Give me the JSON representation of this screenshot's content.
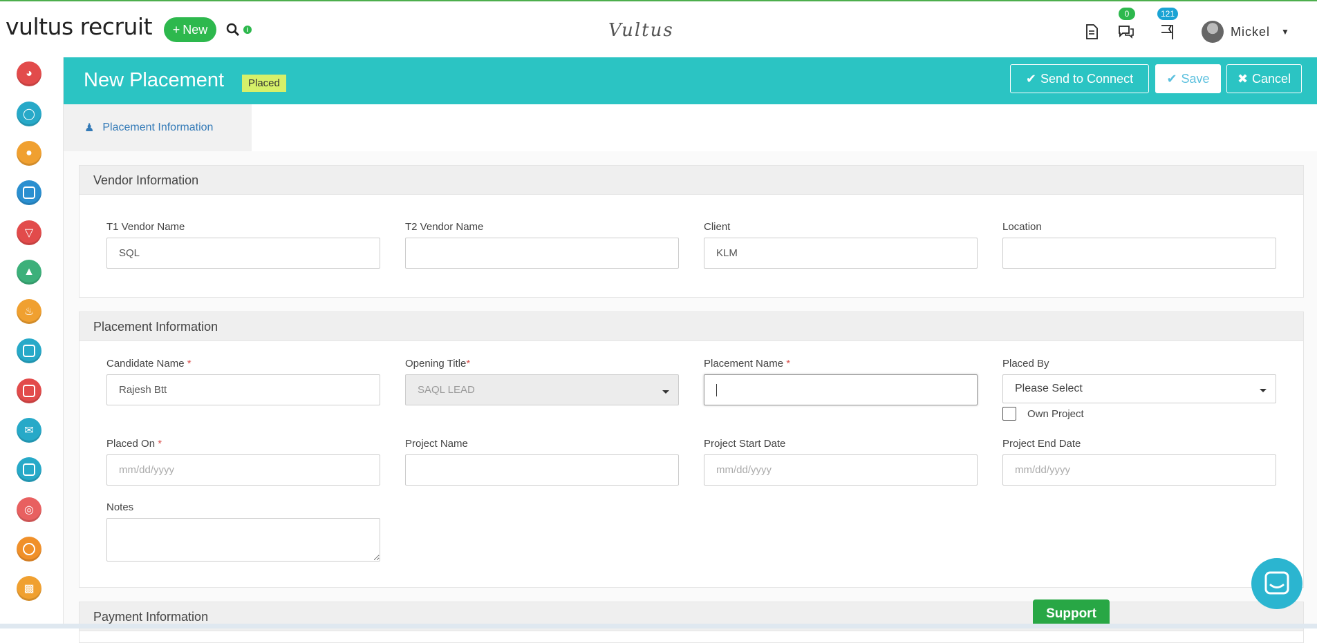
{
  "header": {
    "logo_text": "vultus recruit",
    "new_label": "New",
    "center_brand": "Vultus",
    "messages_count": "0",
    "notifications_count": "121",
    "user_name": "Mickel",
    "colors": {
      "green": "#2db84d",
      "teal": "#2bc4c3",
      "badge_blue": "#1aa3d4"
    }
  },
  "sidebar": {
    "items": [
      {
        "icon": "dashboard-icon",
        "color": "#e24b4b"
      },
      {
        "icon": "headset-icon",
        "color": "#27a9c8"
      },
      {
        "icon": "contacts-icon",
        "color": "#f0a030"
      },
      {
        "icon": "briefcase-icon",
        "color": "#2a8fd0"
      },
      {
        "icon": "funnel-icon",
        "color": "#e24b4b"
      },
      {
        "icon": "candidate-icon",
        "color": "#3cb07a"
      },
      {
        "icon": "hot-list-icon",
        "color": "#f0a030"
      },
      {
        "icon": "submissions-icon",
        "color": "#27a9c8"
      },
      {
        "icon": "interviews-icon",
        "color": "#e24b4b"
      },
      {
        "icon": "email-icon",
        "color": "#27a9c8"
      },
      {
        "icon": "inbox-icon",
        "color": "#27a9c8"
      },
      {
        "icon": "target-icon",
        "color": "#e86060"
      },
      {
        "icon": "sms-icon",
        "color": "#f0902a"
      },
      {
        "icon": "reports-icon",
        "color": "#f0a030"
      }
    ]
  },
  "titlebar": {
    "title": "New Placement",
    "status": "Placed",
    "send_label": "Send to Connect",
    "save_label": "Save",
    "cancel_label": "Cancel"
  },
  "tabs": {
    "active": "Placement Information"
  },
  "vendor": {
    "heading": "Vendor Information",
    "t1_label": "T1 Vendor Name",
    "t1_value": "SQL",
    "t2_label": "T2 Vendor Name",
    "t2_value": "",
    "client_label": "Client",
    "client_value": "KLM",
    "location_label": "Location",
    "location_value": ""
  },
  "placement": {
    "heading": "Placement Information",
    "candidate_label": "Candidate Name",
    "candidate_value": "Rajesh Btt",
    "opening_label": "Opening Title",
    "opening_value": "SAQL LEAD",
    "pname_label": "Placement Name",
    "pname_value": "",
    "placed_by_label": "Placed By",
    "placed_by_value": "Please Select",
    "own_project_label": "Own Project",
    "placed_on_label": "Placed On",
    "placed_on_placeholder": "mm/dd/yyyy",
    "project_name_label": "Project Name",
    "start_label": "Project Start Date",
    "start_placeholder": "mm/dd/yyyy",
    "end_label": "Project End Date",
    "end_placeholder": "mm/dd/yyyy",
    "notes_label": "Notes",
    "required_mark": "*"
  },
  "payment": {
    "heading": "Payment Information"
  },
  "support_label": "Support"
}
